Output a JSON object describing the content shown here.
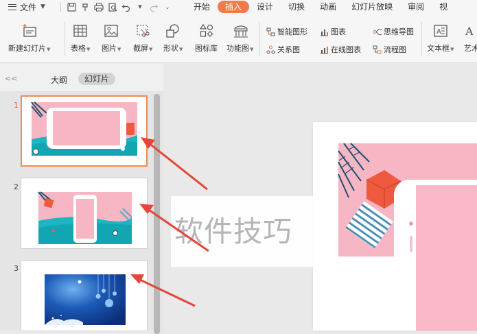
{
  "menubar": {
    "file_label": "文件",
    "tabs": [
      {
        "label": "开始"
      },
      {
        "label": "插入"
      },
      {
        "label": "设计"
      },
      {
        "label": "切换"
      },
      {
        "label": "动画"
      },
      {
        "label": "幻灯片放映"
      },
      {
        "label": "审阅"
      },
      {
        "label": "视"
      }
    ],
    "active_tab": "插入",
    "accent_color": "#ef7b4a"
  },
  "ribbon": {
    "new_slide": "新建幻灯片",
    "table": "表格",
    "picture": "图片",
    "screenshot": "截屏",
    "shape": "形状",
    "icon_library": "图标库",
    "function_chart": "功能图",
    "smart_shape": "智能图形",
    "relation_chart": "关系图",
    "chart": "图表",
    "online_chart": "在线图表",
    "mindmap": "思维导图",
    "flowchart": "流程图",
    "textbox": "文本框",
    "art": "艺术"
  },
  "panel": {
    "tab_outline": "大纲",
    "tab_slides": "幻灯片",
    "slides": [
      {
        "number": "1",
        "selected": true
      },
      {
        "number": "2",
        "selected": false
      },
      {
        "number": "3",
        "selected": false
      }
    ]
  },
  "canvas": {
    "watermark": "软件技巧"
  },
  "colors": {
    "pink": "#f7b6c4",
    "teal": "#1bb6c1",
    "red": "#ef5a3f",
    "navy": "#0b2f7a",
    "arrow": "#e5453a"
  }
}
